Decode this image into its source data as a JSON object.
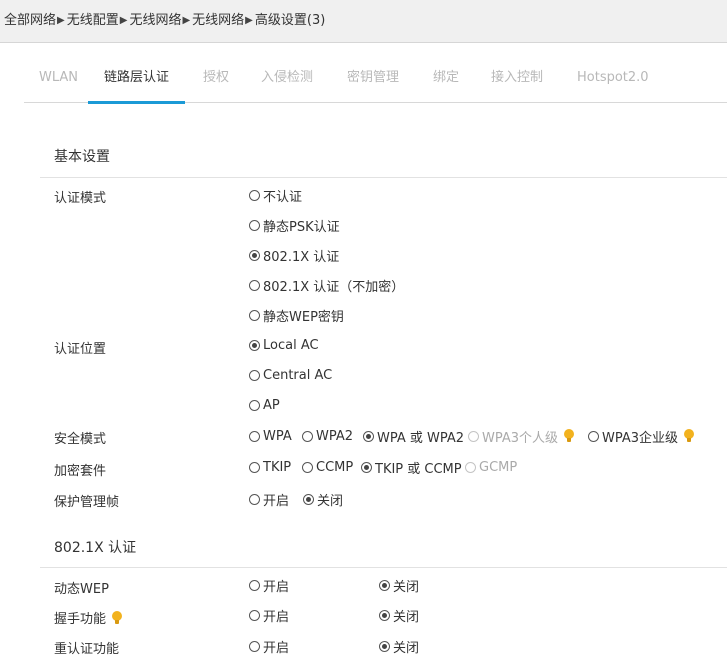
{
  "breadcrumb": [
    "全部网络",
    "无线配置",
    "无线网络",
    "无线网络",
    "高级设置(3)"
  ],
  "tabs": [
    "WLAN",
    "链路层认证",
    "授权",
    "入侵检测",
    "密钥管理",
    "绑定",
    "接入控制",
    "Hotspot2.0"
  ],
  "active_tab": "链路层认证",
  "basic": {
    "title": "基本设置",
    "auth_mode": {
      "label": "认证模式",
      "options": [
        "不认证",
        "静态PSK认证",
        "802.1X 认证",
        "802.1X 认证（不加密）",
        "静态WEP密钥"
      ],
      "selected": "802.1X 认证"
    },
    "auth_location": {
      "label": "认证位置",
      "options": [
        "Local AC",
        "Central AC",
        "AP"
      ],
      "selected": "Local AC"
    },
    "security_mode": {
      "label": "安全模式",
      "options": [
        "WPA",
        "WPA2",
        "WPA 或 WPA2",
        "WPA3个人级",
        "WPA3企业级"
      ],
      "selected": "WPA 或 WPA2",
      "disabled": [
        "WPA3个人级"
      ]
    },
    "cipher_suite": {
      "label": "加密套件",
      "options": [
        "TKIP",
        "CCMP",
        "TKIP 或 CCMP",
        "GCMP"
      ],
      "selected": "TKIP 或 CCMP",
      "disabled": [
        "GCMP"
      ]
    },
    "mgmt_frame": {
      "label": "保护管理帧",
      "options": [
        "开启",
        "关闭"
      ],
      "selected": "关闭"
    }
  },
  "dot1x": {
    "title": "802.1X 认证",
    "dynamic_wep": {
      "label": "动态WEP",
      "options": [
        "开启",
        "关闭"
      ],
      "selected": "关闭"
    },
    "handshake": {
      "label": "握手功能",
      "options": [
        "开启",
        "关闭"
      ],
      "selected": "关闭"
    },
    "reauth": {
      "label": "重认证功能",
      "options": [
        "开启",
        "关闭"
      ],
      "selected": "关闭"
    }
  },
  "colors": {
    "accent": "#1b9ad6",
    "tip_icon": "#f2b21e",
    "topbar_bg": "#f0f0f0"
  },
  "icons": {
    "separator": "chevron-right-icon",
    "tip": "lightbulb-icon"
  }
}
